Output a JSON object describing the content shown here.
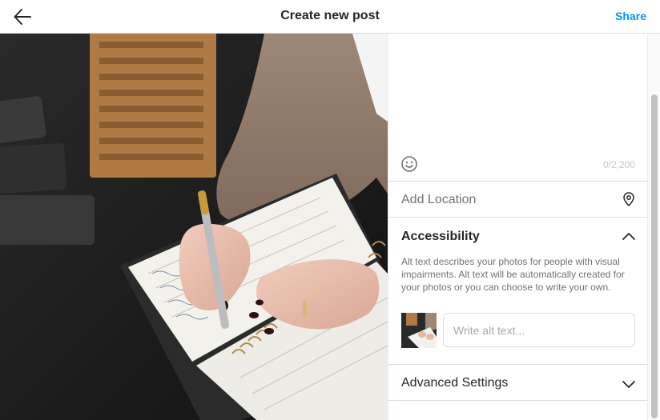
{
  "header": {
    "title": "Create new post",
    "share_label": "Share"
  },
  "caption": {
    "char_count": "0/2,200"
  },
  "location": {
    "label": "Add Location"
  },
  "accessibility": {
    "title": "Accessibility",
    "description": "Alt text describes your photos for people with visual impairments. Alt text will be automatically created for your photos or you can choose to write your own.",
    "alt_placeholder": "Write alt text..."
  },
  "advanced": {
    "label": "Advanced Settings"
  },
  "colors": {
    "accent": "#0095f6",
    "border": "#dbdbdb",
    "muted_text": "#737373"
  }
}
